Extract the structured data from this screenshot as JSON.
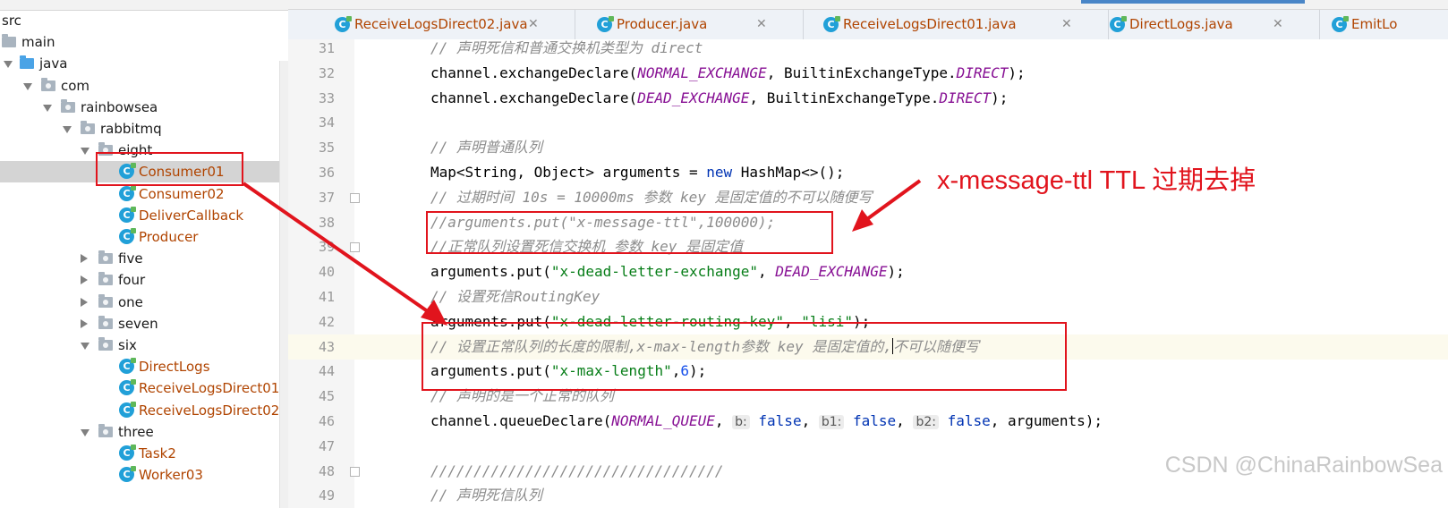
{
  "project_tree": {
    "nodes": [
      {
        "label": "src",
        "kind": "text",
        "depth": 0
      },
      {
        "label": "main",
        "kind": "folder",
        "depth": 0
      },
      {
        "label": "java",
        "kind": "folder-blue",
        "depth": 1,
        "expanded": true
      },
      {
        "label": "com",
        "kind": "package",
        "depth": 2,
        "expanded": true
      },
      {
        "label": "rainbowsea",
        "kind": "package",
        "depth": 3,
        "expanded": true
      },
      {
        "label": "rabbitmq",
        "kind": "package",
        "depth": 4,
        "expanded": true
      },
      {
        "label": "eight",
        "kind": "package",
        "depth": 5,
        "expanded": true
      },
      {
        "label": "Consumer01",
        "kind": "class",
        "depth": 6,
        "selected": true
      },
      {
        "label": "Consumer02",
        "kind": "class",
        "depth": 6
      },
      {
        "label": "DeliverCallback",
        "kind": "class",
        "depth": 6
      },
      {
        "label": "Producer",
        "kind": "class",
        "depth": 6
      },
      {
        "label": "five",
        "kind": "package",
        "depth": 5,
        "expanded": false
      },
      {
        "label": "four",
        "kind": "package",
        "depth": 5,
        "expanded": false
      },
      {
        "label": "one",
        "kind": "package",
        "depth": 5,
        "expanded": false
      },
      {
        "label": "seven",
        "kind": "package",
        "depth": 5,
        "expanded": false
      },
      {
        "label": "six",
        "kind": "package",
        "depth": 5,
        "expanded": true
      },
      {
        "label": "DirectLogs",
        "kind": "class",
        "depth": 6
      },
      {
        "label": "ReceiveLogsDirect01",
        "kind": "class",
        "depth": 6
      },
      {
        "label": "ReceiveLogsDirect02",
        "kind": "class",
        "depth": 6
      },
      {
        "label": "three",
        "kind": "package",
        "depth": 5,
        "expanded": true
      },
      {
        "label": "Task2",
        "kind": "class",
        "depth": 6
      },
      {
        "label": "Worker03",
        "kind": "class",
        "depth": 6
      }
    ]
  },
  "tabs": [
    {
      "label": "ReceiveLogsDirect02.java",
      "closable": true
    },
    {
      "label": "Producer.java",
      "closable": true
    },
    {
      "label": "ReceiveLogsDirect01.java",
      "closable": true
    },
    {
      "label": "DirectLogs.java",
      "closable": true
    },
    {
      "label": "EmitLo",
      "closable": false
    }
  ],
  "editor": {
    "current_line": 43,
    "lines": [
      {
        "n": "31",
        "segs": [
          [
            "cm",
            "// 声明死信和普通交换机类型为 direct"
          ]
        ]
      },
      {
        "n": "32",
        "segs": [
          [
            "",
            "channel.exchangeDeclare("
          ],
          [
            "cst",
            "NORMAL_EXCHANGE"
          ],
          [
            "",
            ", BuiltinExchangeType."
          ],
          [
            "cst",
            "DIRECT"
          ],
          [
            "",
            ");"
          ]
        ]
      },
      {
        "n": "33",
        "segs": [
          [
            "",
            "channel.exchangeDeclare("
          ],
          [
            "cst",
            "DEAD_EXCHANGE"
          ],
          [
            "",
            ", BuiltinExchangeType."
          ],
          [
            "cst",
            "DIRECT"
          ],
          [
            "",
            ");"
          ]
        ]
      },
      {
        "n": "34",
        "segs": []
      },
      {
        "n": "35",
        "segs": [
          [
            "cm",
            "// 声明普通队列"
          ]
        ]
      },
      {
        "n": "36",
        "segs": [
          [
            "",
            "Map<String, Object> arguments = "
          ],
          [
            "kw",
            "new"
          ],
          [
            "",
            " HashMap<>();"
          ]
        ]
      },
      {
        "n": "37",
        "segs": [
          [
            "cm",
            "// 过期时间 10s = 10000ms 参数 key 是固定值的不可以随便写"
          ]
        ]
      },
      {
        "n": "38",
        "segs": [
          [
            "cm",
            "//arguments.put(\"x-message-ttl\",100000);"
          ]
        ]
      },
      {
        "n": "39",
        "segs": [
          [
            "cm",
            "//正常队列设置死信交换机 参数 key 是固定值"
          ]
        ]
      },
      {
        "n": "40",
        "segs": [
          [
            "",
            "arguments.put("
          ],
          [
            "st",
            "\"x-dead-letter-exchange\""
          ],
          [
            "",
            ", "
          ],
          [
            "cst",
            "DEAD_EXCHANGE"
          ],
          [
            "",
            ");"
          ]
        ]
      },
      {
        "n": "41",
        "segs": [
          [
            "cm",
            "// 设置死信RoutingKey"
          ]
        ]
      },
      {
        "n": "42",
        "segs": [
          [
            "",
            "arguments.put("
          ],
          [
            "st",
            "\"x-dead-letter-routing-key\""
          ],
          [
            "",
            ", "
          ],
          [
            "st",
            "\"lisi\""
          ],
          [
            "",
            ");"
          ]
        ]
      },
      {
        "n": "43",
        "segs": [
          [
            "cm",
            "// 设置正常队列的长度的限制,x-max-length参数 key 是固定值的,"
          ],
          [
            "caret",
            ""
          ],
          [
            "cm",
            "不可以随便写"
          ]
        ]
      },
      {
        "n": "44",
        "segs": [
          [
            "",
            "arguments.put("
          ],
          [
            "st",
            "\"x-max-length\""
          ],
          [
            "",
            ","
          ],
          [
            "num",
            "6"
          ],
          [
            "",
            ");"
          ]
        ]
      },
      {
        "n": "45",
        "segs": [
          [
            "cm",
            "// 声明的是一个正常的队列"
          ]
        ]
      },
      {
        "n": "46",
        "segs": [
          [
            "",
            "channel.queueDeclare("
          ],
          [
            "cst",
            "NORMAL_QUEUE"
          ],
          [
            "",
            ", "
          ],
          [
            "hint",
            "b:"
          ],
          [
            "",
            " "
          ],
          [
            "kw",
            "false"
          ],
          [
            "",
            ", "
          ],
          [
            "hint",
            "b1:"
          ],
          [
            "",
            " "
          ],
          [
            "kw",
            "false"
          ],
          [
            "",
            ", "
          ],
          [
            "hint",
            "b2:"
          ],
          [
            "",
            " "
          ],
          [
            "kw",
            "false"
          ],
          [
            "",
            ", arguments);"
          ]
        ]
      },
      {
        "n": "47",
        "segs": []
      },
      {
        "n": "48",
        "segs": [
          [
            "cm",
            "//////////////////////////////////"
          ]
        ]
      },
      {
        "n": "49",
        "segs": [
          [
            "cm",
            "// 声明死信队列"
          ]
        ]
      }
    ]
  },
  "annotation": {
    "text": "x-message-ttl TTL 过期去掉",
    "color": "#e1141d"
  },
  "watermark": "CSDN @ChinaRainbowSea"
}
